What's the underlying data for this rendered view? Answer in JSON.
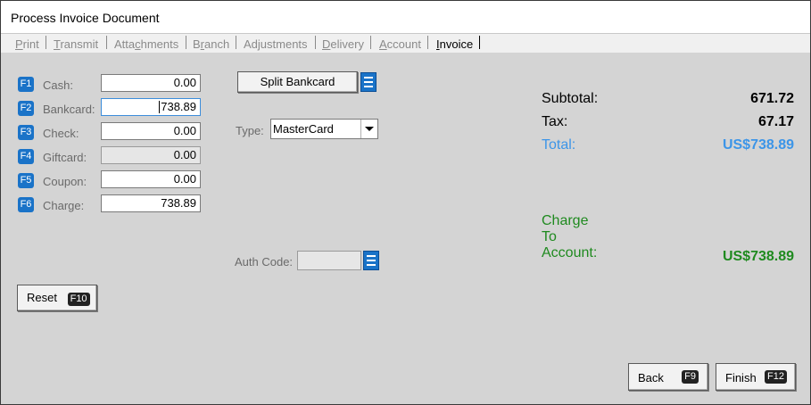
{
  "window": {
    "title": "Process Invoice Document"
  },
  "tabs": [
    {
      "pre": "",
      "u": "P",
      "post": "rint"
    },
    {
      "pre": "",
      "u": "T",
      "post": "ransmit"
    },
    {
      "pre": "Atta",
      "u": "c",
      "post": "hments"
    },
    {
      "pre": "B",
      "u": "r",
      "post": "anch"
    },
    {
      "pre": "Ad",
      "u": "j",
      "post": "ustments"
    },
    {
      "pre": "",
      "u": "D",
      "post": "elivery"
    },
    {
      "pre": "",
      "u": "A",
      "post": "ccount"
    },
    {
      "pre": "",
      "u": "I",
      "post": "nvoice"
    }
  ],
  "payments": [
    {
      "key": "F1",
      "label": "Cash:",
      "value": "0.00"
    },
    {
      "key": "F2",
      "label": "Bankcard:",
      "value": "738.89"
    },
    {
      "key": "F3",
      "label": "Check:",
      "value": "0.00"
    },
    {
      "key": "F4",
      "label": "Giftcard:",
      "value": "0.00"
    },
    {
      "key": "F5",
      "label": "Coupon:",
      "value": "0.00"
    },
    {
      "key": "F6",
      "label": "Charge:",
      "value": "738.89"
    }
  ],
  "split_bankcard": {
    "label": "Split Bankcard"
  },
  "card_type": {
    "label": "Type:",
    "selected": "MasterCard"
  },
  "auth_code": {
    "label": "Auth Code:",
    "value": ""
  },
  "reset": {
    "label": "Reset",
    "key": "F10"
  },
  "summary": {
    "subtotal_label": "Subtotal:",
    "subtotal_value": "671.72",
    "tax_label": "Tax:",
    "tax_value": "67.17",
    "total_label": "Total:",
    "total_value": "US$738.89",
    "charge_line1": "Charge",
    "charge_line2": "To",
    "charge_line3": "Account:",
    "charge_value": "US$738.89"
  },
  "back": {
    "label": "Back",
    "key": "F9"
  },
  "finish": {
    "label": "Finish",
    "key": "F12"
  },
  "colors": {
    "accent": "#1a73c8",
    "total": "#3c95e8",
    "charge": "#1f8a1f",
    "focus": "#3c8ddb"
  }
}
